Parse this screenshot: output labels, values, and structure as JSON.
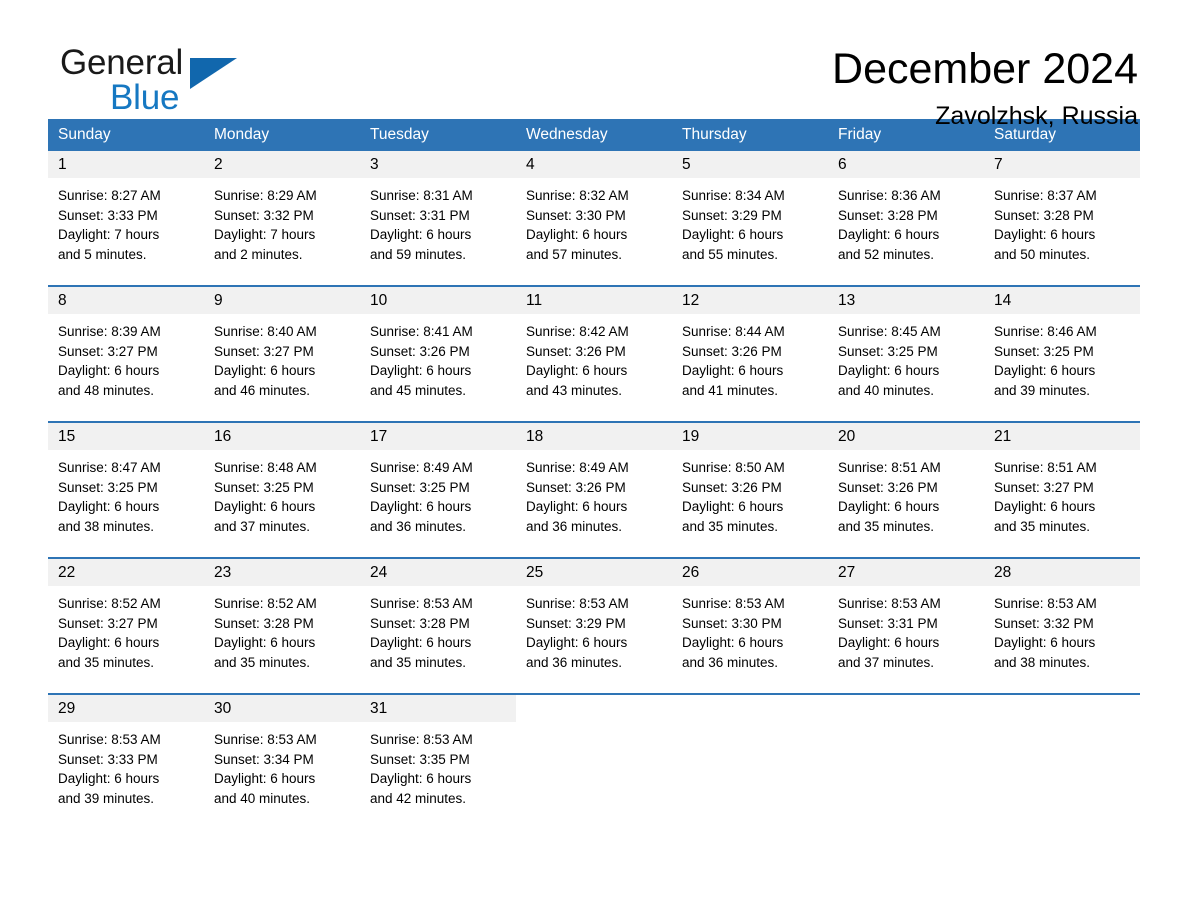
{
  "logo": {
    "word_general": "General",
    "word_blue": "Blue",
    "triangle_color": "#1167ad",
    "blue_color": "#1678c2"
  },
  "header": {
    "title": "December 2024",
    "location": "Zavolzhsk, Russia"
  },
  "theme": {
    "header_blue": "#2e74b5",
    "date_strip_gray": "#f1f1f1",
    "row_divider": "#2e74b5"
  },
  "calendar": {
    "weekdays": [
      "Sunday",
      "Monday",
      "Tuesday",
      "Wednesday",
      "Thursday",
      "Friday",
      "Saturday"
    ],
    "weeks": [
      [
        {
          "day": "1",
          "sunrise": "Sunrise: 8:27 AM",
          "sunset": "Sunset: 3:33 PM",
          "daylight_line1": "Daylight: 7 hours",
          "daylight_line2": "and 5 minutes."
        },
        {
          "day": "2",
          "sunrise": "Sunrise: 8:29 AM",
          "sunset": "Sunset: 3:32 PM",
          "daylight_line1": "Daylight: 7 hours",
          "daylight_line2": "and 2 minutes."
        },
        {
          "day": "3",
          "sunrise": "Sunrise: 8:31 AM",
          "sunset": "Sunset: 3:31 PM",
          "daylight_line1": "Daylight: 6 hours",
          "daylight_line2": "and 59 minutes."
        },
        {
          "day": "4",
          "sunrise": "Sunrise: 8:32 AM",
          "sunset": "Sunset: 3:30 PM",
          "daylight_line1": "Daylight: 6 hours",
          "daylight_line2": "and 57 minutes."
        },
        {
          "day": "5",
          "sunrise": "Sunrise: 8:34 AM",
          "sunset": "Sunset: 3:29 PM",
          "daylight_line1": "Daylight: 6 hours",
          "daylight_line2": "and 55 minutes."
        },
        {
          "day": "6",
          "sunrise": "Sunrise: 8:36 AM",
          "sunset": "Sunset: 3:28 PM",
          "daylight_line1": "Daylight: 6 hours",
          "daylight_line2": "and 52 minutes."
        },
        {
          "day": "7",
          "sunrise": "Sunrise: 8:37 AM",
          "sunset": "Sunset: 3:28 PM",
          "daylight_line1": "Daylight: 6 hours",
          "daylight_line2": "and 50 minutes."
        }
      ],
      [
        {
          "day": "8",
          "sunrise": "Sunrise: 8:39 AM",
          "sunset": "Sunset: 3:27 PM",
          "daylight_line1": "Daylight: 6 hours",
          "daylight_line2": "and 48 minutes."
        },
        {
          "day": "9",
          "sunrise": "Sunrise: 8:40 AM",
          "sunset": "Sunset: 3:27 PM",
          "daylight_line1": "Daylight: 6 hours",
          "daylight_line2": "and 46 minutes."
        },
        {
          "day": "10",
          "sunrise": "Sunrise: 8:41 AM",
          "sunset": "Sunset: 3:26 PM",
          "daylight_line1": "Daylight: 6 hours",
          "daylight_line2": "and 45 minutes."
        },
        {
          "day": "11",
          "sunrise": "Sunrise: 8:42 AM",
          "sunset": "Sunset: 3:26 PM",
          "daylight_line1": "Daylight: 6 hours",
          "daylight_line2": "and 43 minutes."
        },
        {
          "day": "12",
          "sunrise": "Sunrise: 8:44 AM",
          "sunset": "Sunset: 3:26 PM",
          "daylight_line1": "Daylight: 6 hours",
          "daylight_line2": "and 41 minutes."
        },
        {
          "day": "13",
          "sunrise": "Sunrise: 8:45 AM",
          "sunset": "Sunset: 3:25 PM",
          "daylight_line1": "Daylight: 6 hours",
          "daylight_line2": "and 40 minutes."
        },
        {
          "day": "14",
          "sunrise": "Sunrise: 8:46 AM",
          "sunset": "Sunset: 3:25 PM",
          "daylight_line1": "Daylight: 6 hours",
          "daylight_line2": "and 39 minutes."
        }
      ],
      [
        {
          "day": "15",
          "sunrise": "Sunrise: 8:47 AM",
          "sunset": "Sunset: 3:25 PM",
          "daylight_line1": "Daylight: 6 hours",
          "daylight_line2": "and 38 minutes."
        },
        {
          "day": "16",
          "sunrise": "Sunrise: 8:48 AM",
          "sunset": "Sunset: 3:25 PM",
          "daylight_line1": "Daylight: 6 hours",
          "daylight_line2": "and 37 minutes."
        },
        {
          "day": "17",
          "sunrise": "Sunrise: 8:49 AM",
          "sunset": "Sunset: 3:25 PM",
          "daylight_line1": "Daylight: 6 hours",
          "daylight_line2": "and 36 minutes."
        },
        {
          "day": "18",
          "sunrise": "Sunrise: 8:49 AM",
          "sunset": "Sunset: 3:26 PM",
          "daylight_line1": "Daylight: 6 hours",
          "daylight_line2": "and 36 minutes."
        },
        {
          "day": "19",
          "sunrise": "Sunrise: 8:50 AM",
          "sunset": "Sunset: 3:26 PM",
          "daylight_line1": "Daylight: 6 hours",
          "daylight_line2": "and 35 minutes."
        },
        {
          "day": "20",
          "sunrise": "Sunrise: 8:51 AM",
          "sunset": "Sunset: 3:26 PM",
          "daylight_line1": "Daylight: 6 hours",
          "daylight_line2": "and 35 minutes."
        },
        {
          "day": "21",
          "sunrise": "Sunrise: 8:51 AM",
          "sunset": "Sunset: 3:27 PM",
          "daylight_line1": "Daylight: 6 hours",
          "daylight_line2": "and 35 minutes."
        }
      ],
      [
        {
          "day": "22",
          "sunrise": "Sunrise: 8:52 AM",
          "sunset": "Sunset: 3:27 PM",
          "daylight_line1": "Daylight: 6 hours",
          "daylight_line2": "and 35 minutes."
        },
        {
          "day": "23",
          "sunrise": "Sunrise: 8:52 AM",
          "sunset": "Sunset: 3:28 PM",
          "daylight_line1": "Daylight: 6 hours",
          "daylight_line2": "and 35 minutes."
        },
        {
          "day": "24",
          "sunrise": "Sunrise: 8:53 AM",
          "sunset": "Sunset: 3:28 PM",
          "daylight_line1": "Daylight: 6 hours",
          "daylight_line2": "and 35 minutes."
        },
        {
          "day": "25",
          "sunrise": "Sunrise: 8:53 AM",
          "sunset": "Sunset: 3:29 PM",
          "daylight_line1": "Daylight: 6 hours",
          "daylight_line2": "and 36 minutes."
        },
        {
          "day": "26",
          "sunrise": "Sunrise: 8:53 AM",
          "sunset": "Sunset: 3:30 PM",
          "daylight_line1": "Daylight: 6 hours",
          "daylight_line2": "and 36 minutes."
        },
        {
          "day": "27",
          "sunrise": "Sunrise: 8:53 AM",
          "sunset": "Sunset: 3:31 PM",
          "daylight_line1": "Daylight: 6 hours",
          "daylight_line2": "and 37 minutes."
        },
        {
          "day": "28",
          "sunrise": "Sunrise: 8:53 AM",
          "sunset": "Sunset: 3:32 PM",
          "daylight_line1": "Daylight: 6 hours",
          "daylight_line2": "and 38 minutes."
        }
      ],
      [
        {
          "day": "29",
          "sunrise": "Sunrise: 8:53 AM",
          "sunset": "Sunset: 3:33 PM",
          "daylight_line1": "Daylight: 6 hours",
          "daylight_line2": "and 39 minutes."
        },
        {
          "day": "30",
          "sunrise": "Sunrise: 8:53 AM",
          "sunset": "Sunset: 3:34 PM",
          "daylight_line1": "Daylight: 6 hours",
          "daylight_line2": "and 40 minutes."
        },
        {
          "day": "31",
          "sunrise": "Sunrise: 8:53 AM",
          "sunset": "Sunset: 3:35 PM",
          "daylight_line1": "Daylight: 6 hours",
          "daylight_line2": "and 42 minutes."
        },
        {
          "day": "",
          "sunrise": "",
          "sunset": "",
          "daylight_line1": "",
          "daylight_line2": ""
        },
        {
          "day": "",
          "sunrise": "",
          "sunset": "",
          "daylight_line1": "",
          "daylight_line2": ""
        },
        {
          "day": "",
          "sunrise": "",
          "sunset": "",
          "daylight_line1": "",
          "daylight_line2": ""
        },
        {
          "day": "",
          "sunrise": "",
          "sunset": "",
          "daylight_line1": "",
          "daylight_line2": ""
        }
      ]
    ]
  }
}
